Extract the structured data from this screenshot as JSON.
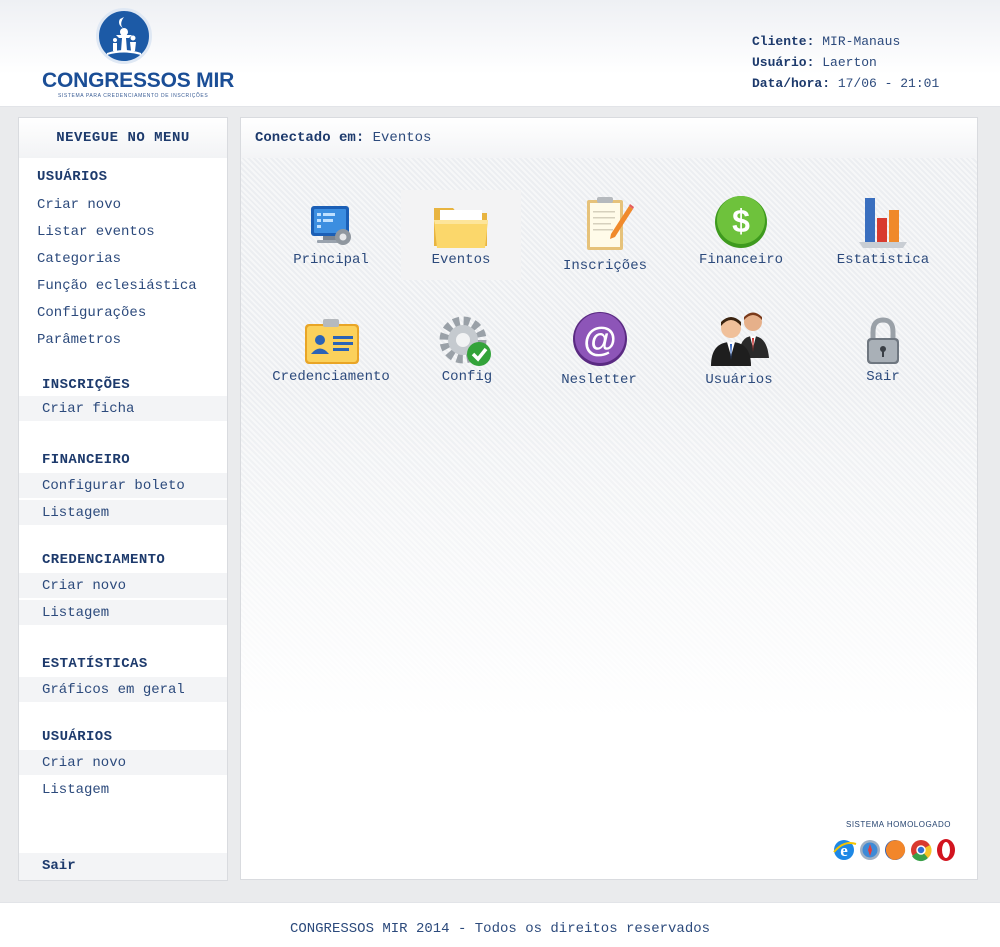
{
  "header": {
    "logo_text": "CONGRESSOS MIR",
    "logo_subtitle": "SISTEMA PARA CREDENCIAMENTO DE INSCRIÇÕES",
    "client_label": "Cliente:",
    "client_value": "MIR-Manaus",
    "user_label": "Usuário:",
    "user_value": "Laerton",
    "datetime_label": "Data/hora:",
    "datetime_value": "17/06 - 21:01"
  },
  "sidebar": {
    "title": "NEVEGUE NO MENU",
    "sections": [
      {
        "heading": "USUÁRIOS",
        "items": [
          "Criar novo",
          "Listar eventos",
          "Categorias",
          "Função eclesiástica",
          "Configurações",
          "Parâmetros"
        ]
      },
      {
        "heading": "INSCRIÇÕES",
        "items": [
          "Criar ficha"
        ]
      },
      {
        "heading": "FINANCEIRO",
        "items": [
          "Configurar boleto",
          "Listagem"
        ]
      },
      {
        "heading": "CREDENCIAMENTO",
        "items": [
          "Criar novo",
          "Listagem"
        ]
      },
      {
        "heading": "ESTATÍSTICAS",
        "items": [
          "Gráficos em geral"
        ]
      },
      {
        "heading": "USUÁRIOS",
        "items": [
          "Criar novo",
          "Listagem"
        ]
      }
    ],
    "logout": "Sair"
  },
  "main": {
    "connected_label": "Conectado em:",
    "connected_value": "Eventos",
    "tiles": [
      {
        "label": "Principal",
        "icon": "monitor-gear-icon"
      },
      {
        "label": "Eventos",
        "icon": "folder-icon"
      },
      {
        "label": "Inscrições",
        "icon": "notepad-pencil-icon"
      },
      {
        "label": "Financeiro",
        "icon": "dollar-icon"
      },
      {
        "label": "Estatistica",
        "icon": "bar-chart-icon"
      },
      {
        "label": "Credenciamento",
        "icon": "id-card-icon"
      },
      {
        "label": "Config",
        "icon": "gear-check-icon"
      },
      {
        "label": "Nesletter",
        "icon": "at-sign-icon"
      },
      {
        "label": "Usuários",
        "icon": "users-icon"
      },
      {
        "label": "Sair",
        "icon": "padlock-icon"
      }
    ],
    "homologated_text": "SISTEMA HOMOLOGADO",
    "browsers": [
      "internet-explorer-icon",
      "safari-icon",
      "firefox-icon",
      "chrome-icon",
      "opera-icon"
    ]
  },
  "footer": {
    "text": "CONGRESSOS MIR 2014 - Todos os direitos reservados"
  }
}
